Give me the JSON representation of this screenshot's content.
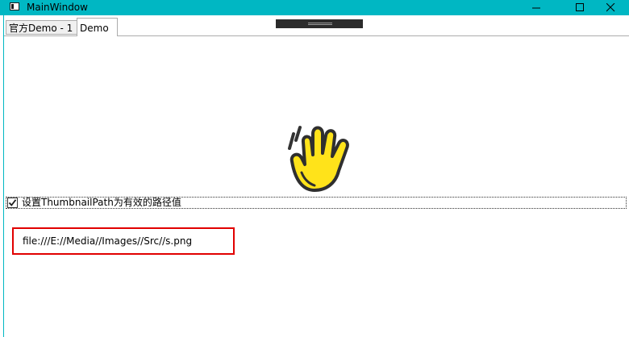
{
  "window": {
    "title": "MainWindow",
    "accent": "#00b7c3"
  },
  "tabs": [
    {
      "label": "官方Demo - 1",
      "selected": false
    },
    {
      "label": "Demo",
      "selected": true
    }
  ],
  "content": {
    "checkbox": {
      "label": "设置ThumbnailPath为有效的路径值",
      "checked": true
    },
    "path_text": "file:///E://Media//Images//Src//s.png",
    "highlight_color": "#e10000",
    "image_icon": "waving-hand-icon"
  }
}
